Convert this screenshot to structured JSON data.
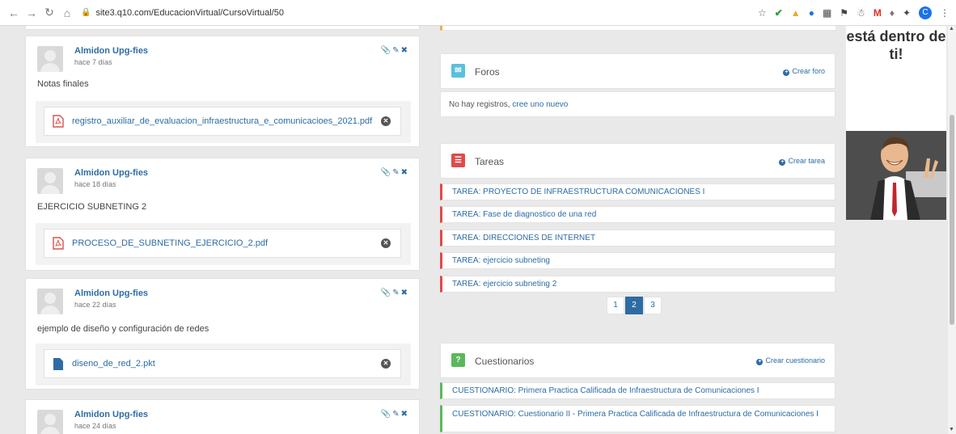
{
  "browser": {
    "url": "site3.q10.com/EducacionVirtual/CursoVirtual/50"
  },
  "posts": [
    {
      "author": "Almidon Upg-fies",
      "time": "hace 7 días",
      "text": "Notas finales",
      "file": "registro_auxiliar_de_evaluacion_infraestructura_e_comunicacioes_2021.pdf",
      "file_type": "pdf-icon"
    },
    {
      "author": "Almidon Upg-fies",
      "time": "hace 18 días",
      "text": "EJERCICIO SUBNETING 2",
      "file": "PROCESO_DE_SUBNETING_EJERCICIO_2.pdf",
      "file_type": "pdf-icon"
    },
    {
      "author": "Almidon Upg-fies",
      "time": "hace 22 días",
      "text": "ejemplo de diseño y configuración de redes",
      "file": "diseno_de_red_2.pkt",
      "file_type": "document-icon"
    },
    {
      "author": "Almidon Upg-fies",
      "time": "hace 24 días"
    }
  ],
  "forums": {
    "title": "Foros",
    "create": "Crear foro",
    "empty_text": "No hay registros,",
    "empty_link": "cree uno nuevo",
    "color": "#5bc0de"
  },
  "tasks": {
    "title": "Tareas",
    "create": "Crear tarea",
    "color": "#e04a4a",
    "items": [
      "TAREA: PROYECTO DE INFRAESTRUCTURA COMUNICACIONES I",
      "TAREA: Fase de diagnostico de una red",
      "TAREA: DIRECCIONES DE INTERNET",
      "TAREA: ejercicio subneting",
      "TAREA: ejercicio subneting 2"
    ],
    "pages": [
      "1",
      "2",
      "3"
    ],
    "current_page": "2"
  },
  "quizzes": {
    "title": "Cuestionarios",
    "create": "Crear cuestionario",
    "color": "#5cb85c",
    "items": [
      "CUESTIONARIO: Primera Practica Calificada de Infraestructura de Comunicaciones I",
      "CUESTIONARIO: Cuestionario II - Primera Practica Calificada de Infraestructura de Comunicaciones I"
    ]
  },
  "ad": {
    "headline": "está dentro de ti!"
  }
}
